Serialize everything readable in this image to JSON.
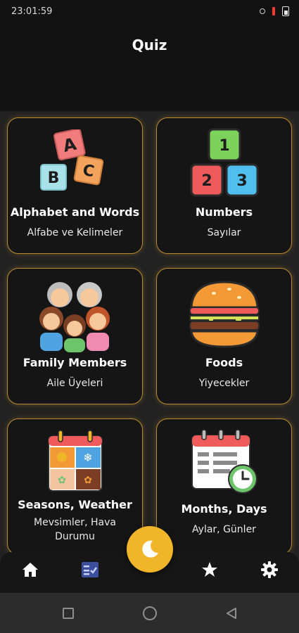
{
  "status_bar": {
    "time": "23:01:59"
  },
  "header": {
    "title": "Quiz"
  },
  "categories": [
    {
      "title": "Alphabet and Words",
      "subtitle": "Alfabe ve Kelimeler",
      "icon": "abc-blocks-icon"
    },
    {
      "title": "Numbers",
      "subtitle": "Sayılar",
      "icon": "number-blocks-icon"
    },
    {
      "title": "Family Members",
      "subtitle": "Aile Üyeleri",
      "icon": "family-icon"
    },
    {
      "title": "Foods",
      "subtitle": "Yiyecekler",
      "icon": "burger-icon"
    },
    {
      "title": "Seasons, Weather",
      "subtitle": "Mevsimler, Hava Durumu",
      "icon": "seasons-calendar-icon"
    },
    {
      "title": "Months, Days",
      "subtitle": "Aylar, Günler",
      "icon": "calendar-clock-icon"
    }
  ],
  "illustration_text": {
    "a": "A",
    "b": "B",
    "c": "C",
    "one": "1",
    "two": "2",
    "three": "3"
  },
  "bottom_nav": {
    "items": [
      "home-icon",
      "quiz-checklist-icon",
      "theme-toggle-moon-icon",
      "star-icon",
      "settings-gear-icon"
    ],
    "active": "quiz-checklist-icon"
  },
  "colors": {
    "accent": "#f1b52a",
    "card_border": "#b98a32",
    "active_nav": "#3b4f9e"
  }
}
